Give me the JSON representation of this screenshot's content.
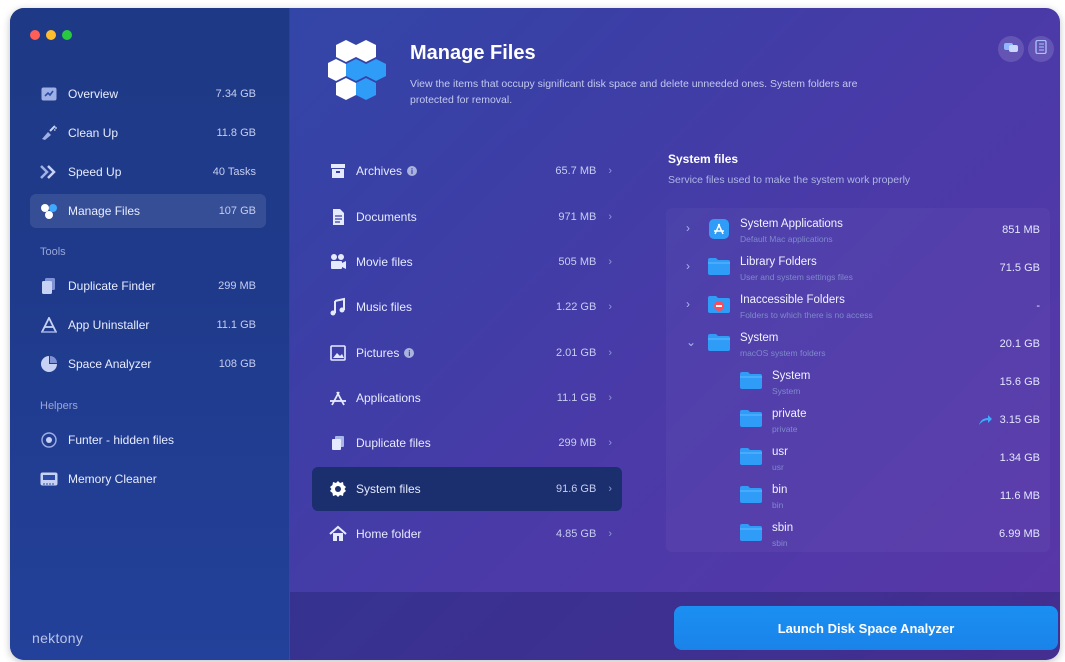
{
  "sidebar": {
    "items": [
      {
        "label": "Overview",
        "value": "7.34 GB"
      },
      {
        "label": "Clean Up",
        "value": "11.8 GB"
      },
      {
        "label": "Speed Up",
        "value": "40 Tasks"
      },
      {
        "label": "Manage Files",
        "value": "107 GB"
      }
    ],
    "tools_title": "Tools",
    "tools": [
      {
        "label": "Duplicate Finder",
        "value": "299 MB"
      },
      {
        "label": "App Uninstaller",
        "value": "11.1 GB"
      },
      {
        "label": "Space Analyzer",
        "value": "108 GB"
      }
    ],
    "helpers_title": "Helpers",
    "helpers": [
      {
        "label": "Funter - hidden files"
      },
      {
        "label": "Memory Cleaner"
      }
    ],
    "brand": "nektony"
  },
  "header": {
    "title": "Manage Files",
    "description": "View the items that occupy significant disk space and delete unneeded ones. System folders are protected for removal."
  },
  "categories": [
    {
      "label": "Archives",
      "value": "65.7 MB"
    },
    {
      "label": "Documents",
      "value": "971 MB"
    },
    {
      "label": "Movie files",
      "value": "505 MB"
    },
    {
      "label": "Music files",
      "value": "1.22 GB"
    },
    {
      "label": "Pictures",
      "value": "2.01 GB"
    },
    {
      "label": "Applications",
      "value": "11.1 GB"
    },
    {
      "label": "Duplicate files",
      "value": "299 MB"
    },
    {
      "label": "System files",
      "value": "91.6 GB"
    },
    {
      "label": "Home folder",
      "value": "4.85 GB"
    }
  ],
  "info_glyph": "i",
  "chevron": "›",
  "detail": {
    "title": "System files",
    "subtitle": "Service files used to make the system work properly",
    "rows": [
      {
        "name": "System Applications",
        "sub": "Default Mac applications",
        "value": "851 MB"
      },
      {
        "name": "Library Folders",
        "sub": "User and system settings files",
        "value": "71.5 GB"
      },
      {
        "name": "Inaccessible Folders",
        "sub": "Folders to which there is no access",
        "value": "-"
      },
      {
        "name": "System",
        "sub": "macOS system folders",
        "value": "20.1 GB"
      },
      {
        "name": "System",
        "sub": "System",
        "value": "15.6 GB"
      },
      {
        "name": "private",
        "sub": "private",
        "value": "3.15 GB"
      },
      {
        "name": "usr",
        "sub": "usr",
        "value": "1.34 GB"
      },
      {
        "name": "bin",
        "sub": "bin",
        "value": "11.6 MB"
      },
      {
        "name": "sbin",
        "sub": "sbin",
        "value": "6.99 MB"
      }
    ]
  },
  "expand_collapsed": "›",
  "expand_open": "⌄",
  "launch_label": "Launch Disk Space Analyzer",
  "colors": {
    "accent": "#1b8ff2",
    "folder": "#2f9df7",
    "active_category": "#1b2f6e"
  }
}
